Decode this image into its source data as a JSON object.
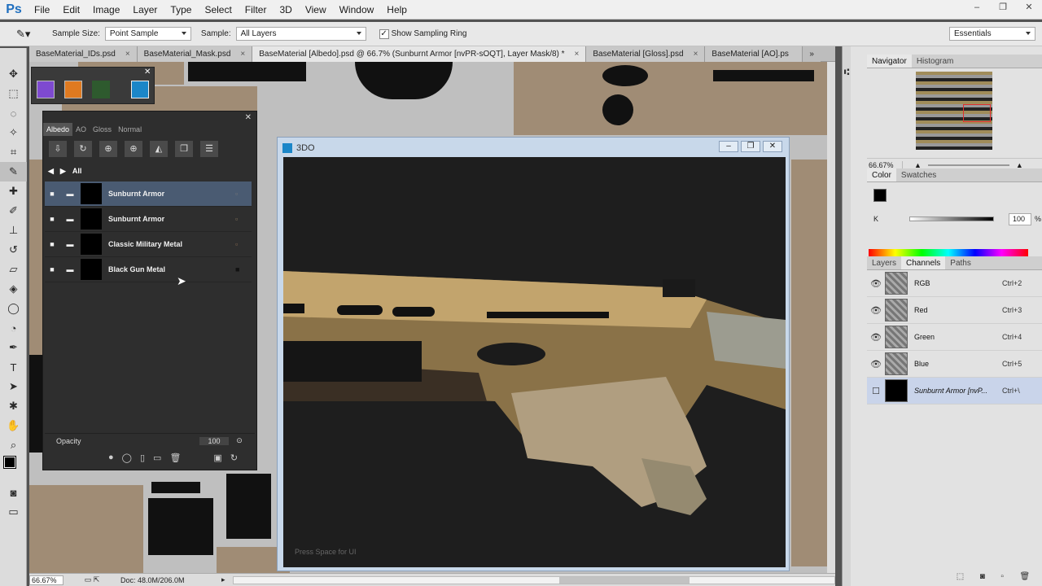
{
  "menubar": {
    "logo": "Ps",
    "items": [
      "File",
      "Edit",
      "Image",
      "Layer",
      "Type",
      "Select",
      "Filter",
      "3D",
      "View",
      "Window",
      "Help"
    ]
  },
  "window_controls": [
    "‒",
    "❐",
    "✕"
  ],
  "options": {
    "sample_size_label": "Sample Size:",
    "sample_size_value": "Point Sample",
    "sample_label": "Sample:",
    "sample_value": "All Layers",
    "show_ring_label": "Show Sampling Ring",
    "workspace": "Essentials"
  },
  "tabs": [
    {
      "label": "BaseMaterial_IDs.psd",
      "close": "×"
    },
    {
      "label": "BaseMaterial_Mask.psd",
      "close": "×"
    },
    {
      "label": "BaseMaterial [Albedo].psd @ 66.7% (Sunburnt Armor [nvPR-sOQT], Layer Mask/8) *",
      "close": "×"
    },
    {
      "label": "BaseMaterial [Gloss].psd",
      "close": "×"
    },
    {
      "label": "BaseMaterial [AO].ps",
      "close": ""
    }
  ],
  "tabs_overflow": "»",
  "status": {
    "zoom": "66.67%",
    "doc": "Doc: 48.0M/206.0M"
  },
  "ddo": {
    "tabs": [
      "Albedo",
      "AO",
      "Gloss",
      "Normal"
    ],
    "breadcrumb": "All",
    "layers": [
      {
        "name": "Sunburnt Armor",
        "selected": true
      },
      {
        "name": "Sunburnt Armor",
        "selected": false
      },
      {
        "name": "Classic Military Metal",
        "selected": false
      },
      {
        "name": "Black Gun Metal",
        "selected": false
      }
    ],
    "opacity_label": "Opacity",
    "opacity_value": "100"
  },
  "win3d": {
    "title": "3DO",
    "hint": "Press Space for UI"
  },
  "navigator": {
    "tabs": [
      "Navigator",
      "Histogram"
    ],
    "zoom": "66.67%"
  },
  "color_panel": {
    "tabs": [
      "Color",
      "Swatches"
    ],
    "channel": "K",
    "value": "100",
    "unit": "%"
  },
  "channels_panel": {
    "tabs": [
      "Layers",
      "Channels",
      "Paths"
    ],
    "rows": [
      {
        "name": "RGB",
        "key": "Ctrl+2",
        "visible": true
      },
      {
        "name": "Red",
        "key": "Ctrl+3",
        "visible": true
      },
      {
        "name": "Green",
        "key": "Ctrl+4",
        "visible": true
      },
      {
        "name": "Blue",
        "key": "Ctrl+5",
        "visible": true
      },
      {
        "name": "Sunburnt Armor [nvP...",
        "key": "Ctrl+\\",
        "visible": false
      }
    ]
  }
}
